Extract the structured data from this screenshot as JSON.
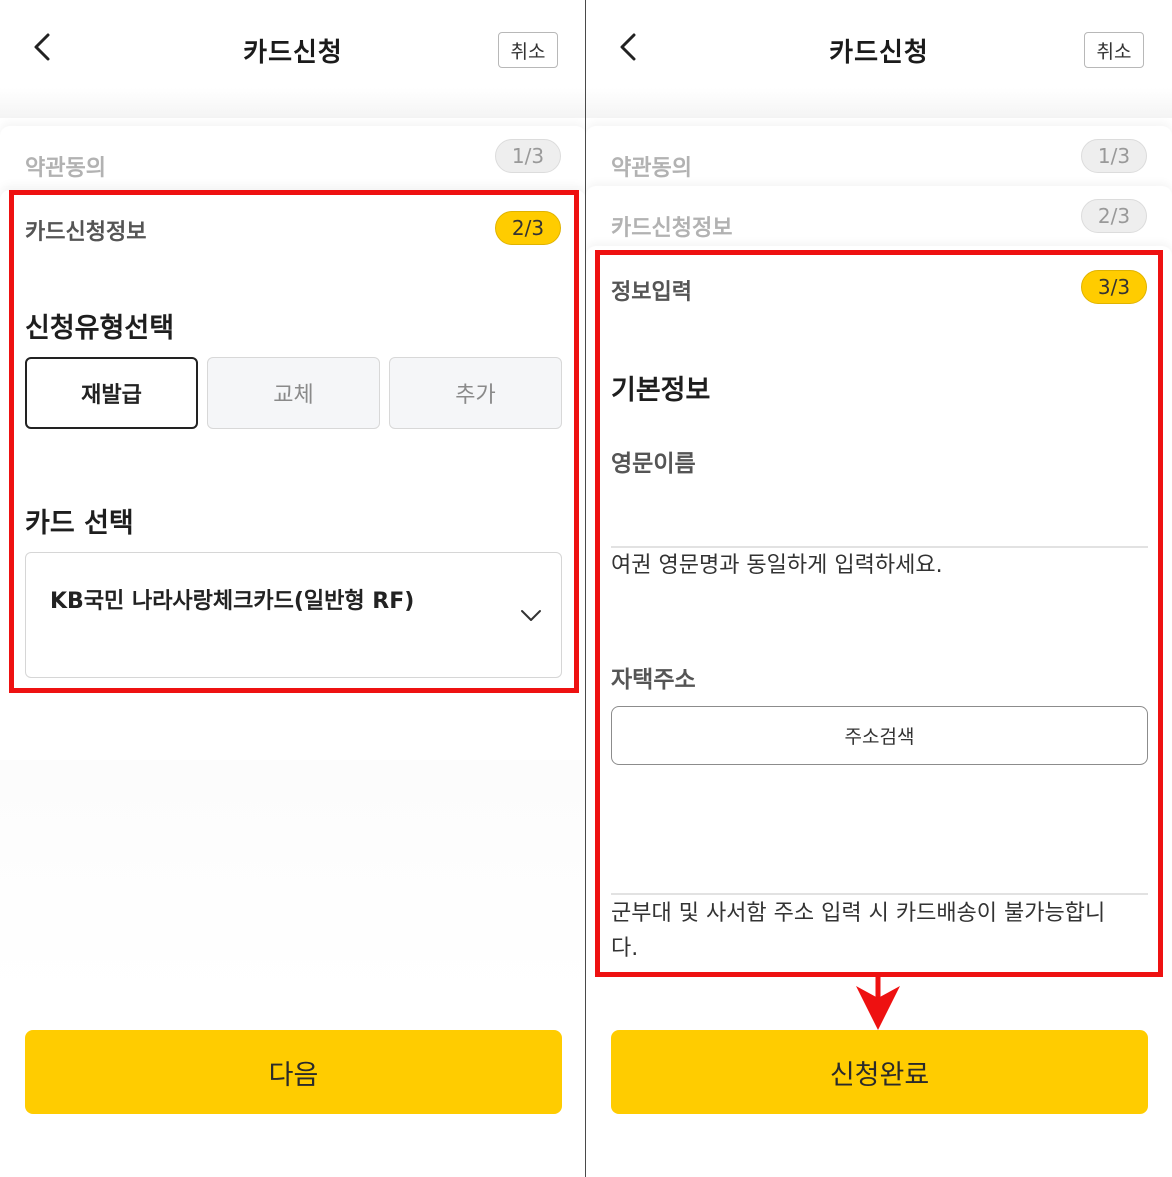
{
  "colors": {
    "accent_yellow": "#ffcc00",
    "highlight_red": "#ee1111"
  },
  "icons": {
    "back": "chevron-left-icon",
    "dropdown": "chevron-down-icon",
    "arrow": "arrow-down-icon"
  },
  "left": {
    "header": {
      "title": "카드신청",
      "cancel_label": "취소"
    },
    "steps": [
      {
        "label": "약관동의",
        "badge": "1/3"
      },
      {
        "label": "카드신청정보",
        "badge": "2/3"
      }
    ],
    "type_section": {
      "title": "신청유형선택",
      "options": [
        {
          "label": "재발급",
          "selected": true
        },
        {
          "label": "교체",
          "selected": false
        },
        {
          "label": "추가",
          "selected": false
        }
      ]
    },
    "card_section": {
      "title": "카드 선택",
      "selected_card": "KB국민 나라사랑체크카드(일반형 RF)"
    },
    "next_button": "다음"
  },
  "right": {
    "header": {
      "title": "카드신청",
      "cancel_label": "취소"
    },
    "steps": [
      {
        "label": "약관동의",
        "badge": "1/3"
      },
      {
        "label": "카드신청정보",
        "badge": "2/3"
      },
      {
        "label": "정보입력",
        "badge": "3/3"
      }
    ],
    "basic_info": {
      "title": "기본정보",
      "english_name_label": "영문이름",
      "english_name_value": "",
      "english_name_help": "여권 영문명과 동일하게 입력하세요.",
      "address_label": "자택주소",
      "address_search_button": "주소검색",
      "address_value": "",
      "address_help_line1": "군부대 및 사서함 주소 입력 시 카드배송이 불가능합니",
      "address_help_line2": "다."
    },
    "complete_button": "신청완료"
  }
}
